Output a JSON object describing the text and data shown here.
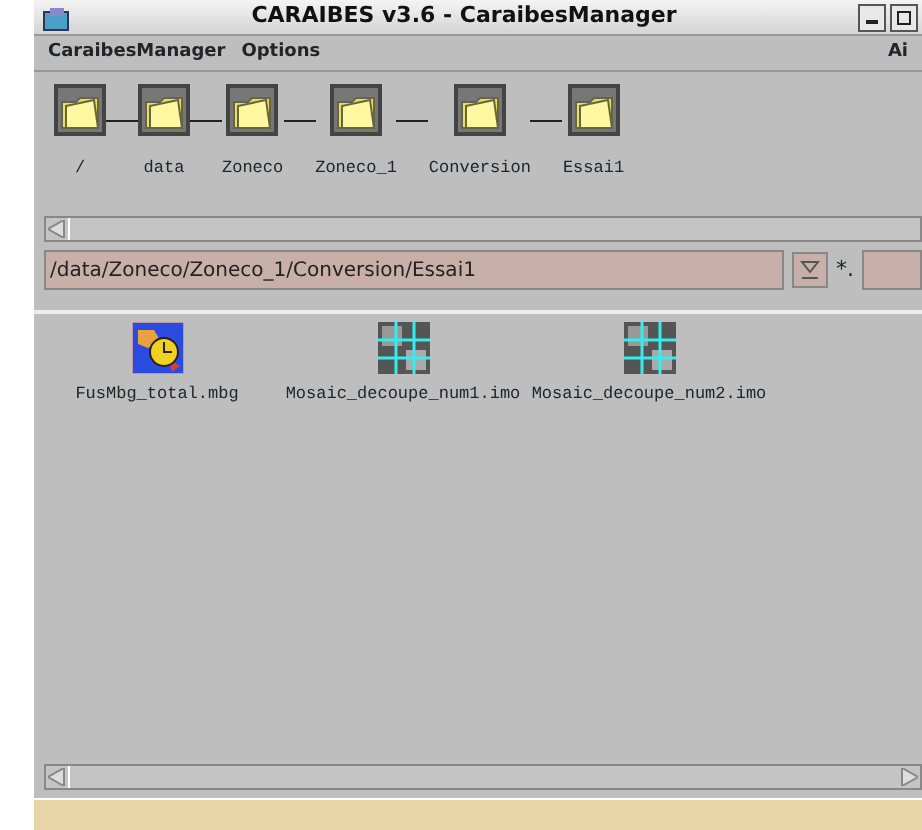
{
  "window": {
    "title": "CARAIBES v3.6 - CaraibesManager"
  },
  "menu": [
    "CaraibesManager",
    "Options",
    "Ai"
  ],
  "breadcrumb": [
    {
      "label": "/"
    },
    {
      "label": "data"
    },
    {
      "label": "Zoneco"
    },
    {
      "label": "Zoneco_1"
    },
    {
      "label": "Conversion"
    },
    {
      "label": "Essai1"
    }
  ],
  "path_field": {
    "value": "/data/Zoneco/Zoneco_1/Conversion/Essai1"
  },
  "filter": {
    "label": "*."
  },
  "files": [
    {
      "name": "FusMbg_total.mbg",
      "kind": "mbg"
    },
    {
      "name": "Mosaic_decoupe_num1.imo",
      "kind": "imo"
    },
    {
      "name": "Mosaic_decoupe_num2.imo",
      "kind": "imo"
    }
  ]
}
